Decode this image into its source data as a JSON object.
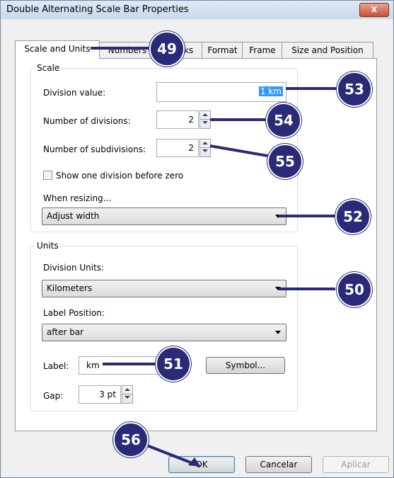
{
  "window": {
    "title": "Double Alternating Scale Bar Properties",
    "close_glyph": "x"
  },
  "tabs": [
    {
      "label": "Scale and Units"
    },
    {
      "label": "Numbers and Marks"
    },
    {
      "label": "Format"
    },
    {
      "label": "Frame"
    },
    {
      "label": "Size and Position"
    }
  ],
  "scale": {
    "legend": "Scale",
    "division_value_label": "Division value:",
    "division_value": "1 km",
    "num_divisions_label": "Number of divisions:",
    "num_divisions": "2",
    "num_subdivisions_label": "Number of subdivisions:",
    "num_subdivisions": "2",
    "show_one_division_label": "Show one division before zero",
    "show_one_division_checked": false,
    "when_resizing_label": "When resizing...",
    "when_resizing_value": "Adjust width"
  },
  "units": {
    "legend": "Units",
    "division_units_label": "Division Units:",
    "division_units_value": "Kilometers",
    "label_position_label": "Label Position:",
    "label_position_value": "after bar",
    "label_label": "Label:",
    "label_value": "km",
    "symbol_button": "Symbol...",
    "gap_label": "Gap:",
    "gap_value": "3 pt"
  },
  "buttons": {
    "ok": "OK",
    "cancel": "Cancelar",
    "apply": "Aplicar"
  },
  "callouts": [
    "49",
    "50",
    "51",
    "52",
    "53",
    "54",
    "55",
    "56"
  ],
  "colors": {
    "callout": "#2a2a78",
    "selection": "#3399ff"
  }
}
